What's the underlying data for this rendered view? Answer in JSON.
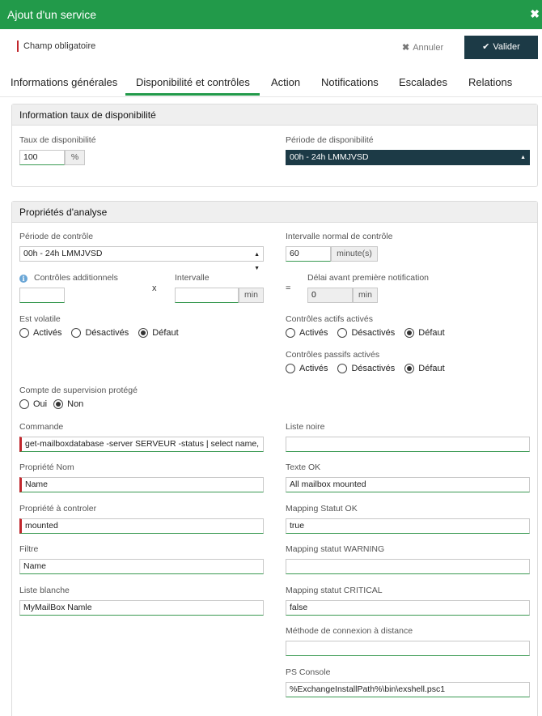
{
  "window": {
    "title": "Ajout d'un service",
    "close_glyph": "✖"
  },
  "required_note": "Champ obligatoire",
  "toolbar": {
    "cancel_label": "Annuler",
    "validate_label": "Valider"
  },
  "tabs": [
    {
      "label": "Informations générales",
      "active": false
    },
    {
      "label": "Disponibilité et contrôles",
      "active": true
    },
    {
      "label": "Action",
      "active": false
    },
    {
      "label": "Notifications",
      "active": false
    },
    {
      "label": "Escalades",
      "active": false
    },
    {
      "label": "Relations",
      "active": false
    }
  ],
  "availability": {
    "heading": "Information taux de disponibilité",
    "rate_label": "Taux de disponibilité",
    "rate_value": "100",
    "rate_unit": "%",
    "period_label": "Période de disponibilité",
    "period_value": "00h - 24h LMMJVSD"
  },
  "analysis": {
    "heading": "Propriétés d'analyse",
    "check_period_label": "Période de contrôle",
    "check_period_value": "00h - 24h LMMJVSD",
    "normal_interval_label": "Intervalle normal de contrôle",
    "normal_interval_value": "60",
    "normal_interval_unit": "minute(s)",
    "additional_checks_label": "Contrôles additionnels",
    "additional_checks_value": "",
    "times_symbol": "x",
    "interval_label": "Intervalle",
    "interval_value": "",
    "interval_unit": "min",
    "equals_symbol": "=",
    "first_notif_delay_label": "Délai avant première notification",
    "first_notif_delay_value": "0",
    "first_notif_delay_unit": "min",
    "volatile_label": "Est volatile",
    "volatile_options": [
      "Activés",
      "Désactivés",
      "Défaut"
    ],
    "volatile_selected": "Défaut",
    "active_checks_label": "Contrôles actifs activés",
    "active_checks_options": [
      "Activés",
      "Désactivés",
      "Défaut"
    ],
    "active_checks_selected": "Défaut",
    "passive_checks_label": "Contrôles passifs activés",
    "passive_checks_options": [
      "Activés",
      "Désactivés",
      "Défaut"
    ],
    "passive_checks_selected": "Défaut",
    "protected_label": "Compte de supervision protégé",
    "protected_options": [
      "Oui",
      "Non"
    ],
    "protected_selected": "Non",
    "command_label": "Commande",
    "command_value": "get-mailboxdatabase -server SERVEUR -status | select name,",
    "blacklist_label": "Liste noire",
    "blacklist_value": "",
    "property_name_label": "Propriété Nom",
    "property_name_value": "Name",
    "ok_text_label": "Texte OK",
    "ok_text_value": "All mailbox mounted",
    "property_check_label": "Propriété à controler",
    "property_check_value": "mounted",
    "mapping_ok_label": "Mapping Statut OK",
    "mapping_ok_value": "true",
    "filter_label": "Filtre",
    "filter_value": "Name",
    "mapping_warning_label": "Mapping statut WARNING",
    "mapping_warning_value": "",
    "whitelist_label": "Liste blanche",
    "whitelist_value": "MyMailBox Namle",
    "mapping_critical_label": "Mapping statut CRITICAL",
    "mapping_critical_value": "false",
    "remote_method_label": "Méthode de connexion à distance",
    "remote_method_value": "",
    "ps_console_label": "PS Console",
    "ps_console_value": "%ExchangeInstallPath%\\bin\\exshell.psc1"
  },
  "colors": {
    "header_green": "#229a4a",
    "dark_button": "#1c3a46",
    "required_red": "#c1272d"
  },
  "icons": {
    "close": "close-icon",
    "cancel": "x-icon",
    "validate": "check-icon",
    "info": "info-icon",
    "select": "select-arrows-icon"
  }
}
